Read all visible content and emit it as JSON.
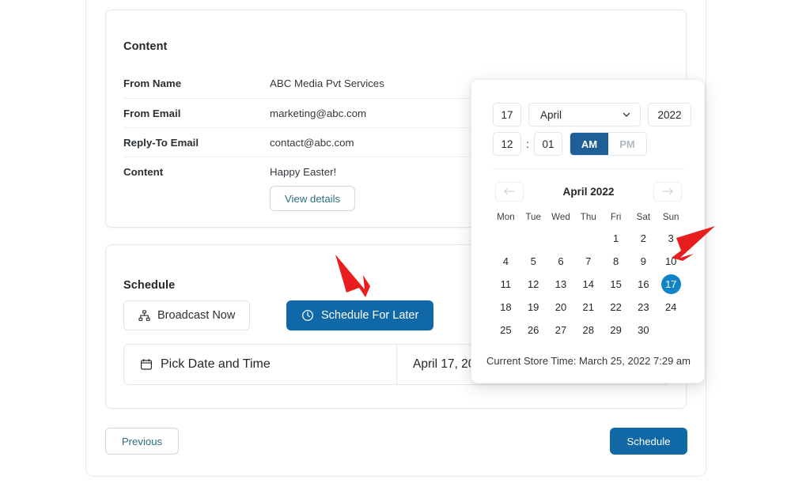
{
  "content_card": {
    "title": "Content",
    "rows": [
      {
        "label": "From Name",
        "value": "ABC Media Pvt Services"
      },
      {
        "label": "From Email",
        "value": "marketing@abc.com"
      },
      {
        "label": "Reply-To Email",
        "value": "contact@abc.com"
      },
      {
        "label": "Content",
        "value": "Happy Easter!"
      }
    ],
    "view_details_label": "View details"
  },
  "schedule_card": {
    "title": "Schedule",
    "broadcast_now_label": "Broadcast Now",
    "schedule_later_label": "Schedule For Later",
    "pick_label": "Pick Date and Time",
    "pick_value": "April 17, 20"
  },
  "footer": {
    "previous_label": "Previous",
    "schedule_label": "Schedule"
  },
  "datepicker": {
    "day": "17",
    "month": "April",
    "year": "2022",
    "hour": "12",
    "colon": ":",
    "minute": "01",
    "am_label": "AM",
    "pm_label": "PM",
    "meridiem_selected": "AM",
    "calendar_title": "April 2022",
    "prev_glyph": "←",
    "next_glyph": "→",
    "chevron_glyph": "⌄",
    "weekdays": [
      "Mon",
      "Tue",
      "Wed",
      "Thu",
      "Fri",
      "Sat",
      "Sun"
    ],
    "leading_blanks": 4,
    "days": [
      1,
      2,
      3,
      4,
      5,
      6,
      7,
      8,
      9,
      10,
      11,
      12,
      13,
      14,
      15,
      16,
      17,
      18,
      19,
      20,
      21,
      22,
      23,
      24,
      25,
      26,
      27,
      28,
      29,
      30
    ],
    "selected_day": 17,
    "footer_text": "Current Store Time: March 25, 2022 7:29 am"
  },
  "colors": {
    "primary_blue": "#1168a6",
    "selected_day_blue": "#1183c9",
    "meridiem_blue": "#1d5f96",
    "link_teal": "#2e6e80",
    "arrow_red": "#e81d1d"
  }
}
